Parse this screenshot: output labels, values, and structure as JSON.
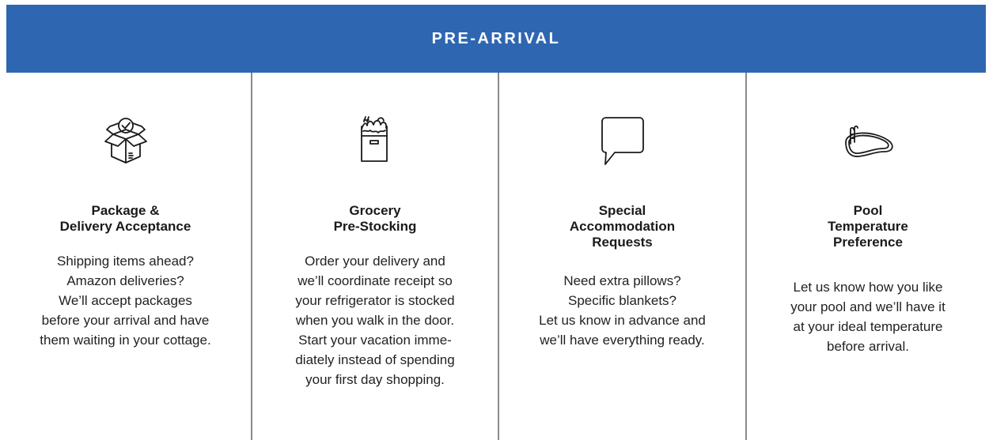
{
  "banner": {
    "title": "PRE-ARRIVAL",
    "color": "#2f66b2"
  },
  "services": [
    {
      "icon": "package-icon",
      "title_lines": [
        "Package &",
        "Delivery Acceptance"
      ],
      "desc_lines": [
        "Shipping items ahead?",
        "Amazon deliveries?",
        "We’ll accept packages",
        "before your arrival and have",
        "them waiting in your cottage."
      ]
    },
    {
      "icon": "grocery-bag-icon",
      "title_lines": [
        "Grocery",
        "Pre-Stocking"
      ],
      "desc_lines": [
        "Order your delivery and",
        "we’ll coordinate receipt so",
        "your refrigerator is stocked",
        "when you walk in the door.",
        "Start your vacation imme-",
        "diately instead of spending",
        "your first day shopping."
      ]
    },
    {
      "icon": "speech-bubble-icon",
      "title_lines": [
        "Special",
        "Accommodation",
        "Requests"
      ],
      "desc_lines": [
        "Need extra pillows?",
        "Specific blankets?",
        "Let us know in advance and",
        "we’ll have everything ready."
      ]
    },
    {
      "icon": "pool-icon",
      "title_lines": [
        "Pool",
        "Temperature",
        "Preference"
      ],
      "desc_lines": [
        "Let us know how you like",
        "your pool and we’ll have it",
        "at your ideal temperature",
        "before arrival."
      ]
    }
  ]
}
